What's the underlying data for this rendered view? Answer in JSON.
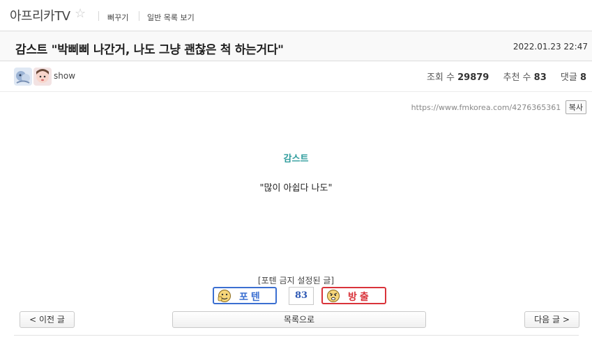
{
  "header": {
    "board_title": "아프리카TV",
    "star": "☆",
    "links": [
      "뻐꾸기",
      "일반 목록 보기"
    ]
  },
  "post": {
    "title": "감스트 \"박삐삐 나간거, 나도 그냥 괜찮은 척 하는거다\"",
    "date": "2022.01.23 22:47",
    "author": "show",
    "stats": {
      "views_label": "조회 수",
      "views": "29879",
      "recommend_label": "추천 수",
      "recommend": "83",
      "comments_label": "댓글",
      "comments": "8"
    },
    "url": "https://www.fmkorea.com/4276365361",
    "copy_label": "복사",
    "content": {
      "heading": "감스트",
      "quote": "\"많이 아쉽다 나도\""
    }
  },
  "vote": {
    "notice": "[포텐 금지 설정된 글]",
    "up_label": "포텐",
    "count": "83",
    "down_label": "방출"
  },
  "nav": {
    "prev": "< 이전 글",
    "list": "목록으로",
    "next": "다음 글 >"
  },
  "colors": {
    "accent_teal": "#2e9c9c",
    "vote_up": "#3b6fd1",
    "vote_down": "#d9333a",
    "count": "#2d58b4"
  }
}
